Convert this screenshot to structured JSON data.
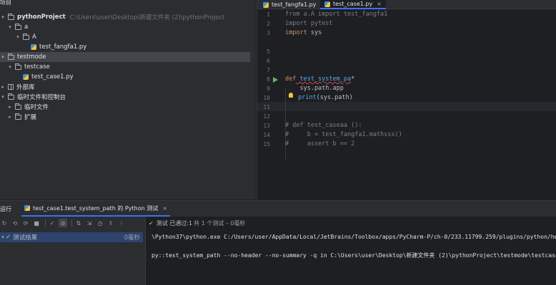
{
  "project": {
    "title": "项目",
    "root_label": "pythonProject",
    "root_path": "C:\\Users\\user\\Desktop\\新建文件夹 (2)\\pythonProject",
    "items": [
      {
        "label": "a"
      },
      {
        "label": "A"
      },
      {
        "label": "test_fangfa1.py"
      },
      {
        "label": "testmode"
      },
      {
        "label": "testcase"
      },
      {
        "label": "test_case1.py"
      },
      {
        "label": "外部库"
      },
      {
        "label": "临时文件和控制台"
      },
      {
        "label": "临时文件"
      },
      {
        "label": "扩展"
      }
    ]
  },
  "editor": {
    "tabs": [
      {
        "label": "test_fangfa1.py"
      },
      {
        "label": "test_case1.py"
      }
    ],
    "line_numbers": [
      "1",
      "2",
      "3",
      "4",
      "5",
      "6",
      "7",
      "8",
      "9",
      "10",
      "11",
      "12",
      "13",
      "14",
      "15"
    ],
    "code": {
      "l1": "from a.A import test_fangfa1",
      "l2_kw": "import",
      "l2_rest": " pytest",
      "l3_kw": "import",
      "l3_rest": " sys",
      "l8_kw": "def",
      "l8_fn": " test_system_pa",
      "l8_rest": "*",
      "l9": "    sys.path.app",
      "l10_fn": "print",
      "l10_rest": "(sys.path)",
      "l13": "# def test_caseaa ():",
      "l14": "#     b = test_fangfa1.mathsss()",
      "l15": "#     assert b == 2"
    }
  },
  "run": {
    "title": "运行",
    "tab_label": "test_case1.test_system_path 的 Python 测试",
    "tree_root_label": "测试结果",
    "tree_root_duration": "0毫秒",
    "status_prefix": "测试 已通过: ",
    "status_count": "1",
    "status_rest": "共 1 个测试 – 0毫秒",
    "console_line1": "\\Python37\\python.exe C:/Users/user/AppData/Local/JetBrains/Toolbox/apps/PyCharm-P/ch-0/233.11799.259/plugins/python/helpers",
    "console_line2": "py::test_system_path --no-header --no-summary -q in C:\\Users\\user\\Desktop\\新建文件夹 (2)\\pythonProject\\testmode\\testcase"
  },
  "colors": {
    "accent": "#3574f0",
    "success": "#5fb865",
    "keyword": "#cf8e6d",
    "function": "#56a8f5"
  }
}
